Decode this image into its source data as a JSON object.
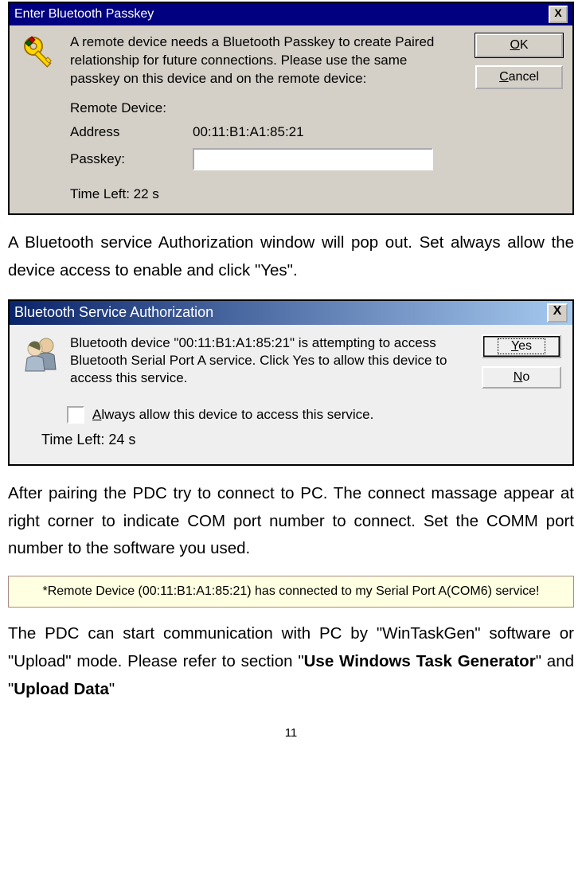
{
  "dialog1": {
    "title": "Enter Bluetooth Passkey",
    "close": "X",
    "icon_name": "key-icon",
    "message": "A remote device needs a Bluetooth Passkey to create Paired relationship for future connections. Please use the same passkey on this device and on the remote device:",
    "ok_label": "OK",
    "ok_ul": "O",
    "cancel_label": "ancel",
    "cancel_ul": "C",
    "remote_device_label": "Remote Device:",
    "address_label": "Address",
    "address_value": "00:11:B1:A1:85:21",
    "passkey_label": "Passkey:",
    "passkey_value": "",
    "time_left": "Time Left: 22 s"
  },
  "para1": "A Bluetooth service Authorization window will pop out. Set always allow the device access to enable and click \"Yes\".",
  "dialog2": {
    "title": "Bluetooth Service Authorization",
    "close": "X",
    "icon_name": "people-icon",
    "message": "Bluetooth device \"00:11:B1:A1:85:21\" is attempting to access Bluetooth Serial Port A service. Click Yes to allow this device to access this service.",
    "yes_label": "es",
    "yes_ul": "Y",
    "no_label": "o",
    "no_ul": "N",
    "checkbox_label": "lways allow this device to access this service.",
    "checkbox_ul": "A",
    "time_left": "Time Left: 24 s"
  },
  "para2": "After pairing the PDC try to connect to PC. The connect massage appear at right corner to indicate COM port number to connect. Set the COMM port number to the software you used.",
  "toast": "*Remote Device (00:11:B1:A1:85:21)  has connected to my  Serial Port A(COM6) service!",
  "para3_a": "The PDC can start communication with PC by \"WinTaskGen\" software or \"Upload\" mode. Please refer to section \"",
  "para3_b": "Use Windows Task Generator",
  "para3_c": "\" and \"",
  "para3_d": "Upload Data",
  "para3_e": "\"",
  "page_number": "11"
}
